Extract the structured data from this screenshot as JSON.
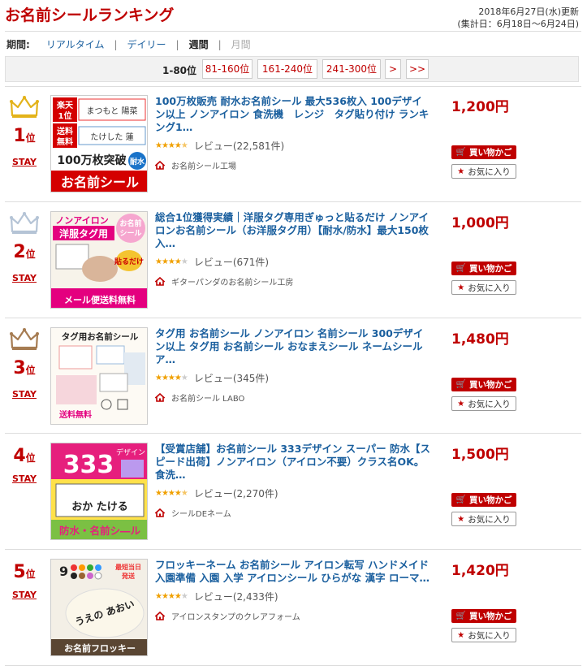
{
  "page": {
    "title": "お名前シールランキング",
    "updated_line1": "2018年6月27日(水)更新",
    "updated_line2": "(集計日：6月18日～6月24日)"
  },
  "period": {
    "label": "期間:",
    "options": [
      "リアルタイム",
      "デイリー",
      "週間",
      "月間"
    ],
    "selected": "週間"
  },
  "pagination": {
    "current": "1-80位",
    "pages": [
      "81-160位",
      "161-240位",
      "241-300位",
      ">",
      ">>"
    ]
  },
  "items": [
    {
      "rank": "1",
      "rank_suffix": "位",
      "movement": "STAY",
      "crown": "gold",
      "title": "100万枚販売 耐水お名前シール 最大536枚入 100デザイン以上 ノンアイロン 食洗機　レンジ　タグ貼り付け ランキング1…",
      "rating": 4.5,
      "reviews": "レビュー(22,581件)",
      "shop": "お名前シール工場",
      "price": "1,200円",
      "thumb": {
        "l1": "楽天1位",
        "l2": "まつもと 陽菜",
        "l3": "送料無料",
        "l4": "たけした 蓮",
        "l5": "100万枚突破",
        "l6": "耐水",
        "l7": "お名前シール"
      }
    },
    {
      "rank": "2",
      "rank_suffix": "位",
      "movement": "STAY",
      "crown": "silver",
      "title": "総合1位獲得実績｜洋服タグ専用ぎゅっと貼るだけ ノンアイロンお名前シール（お洋服タグ用）【耐水/防水】最大150枚入…",
      "rating": 4.0,
      "reviews": "レビュー(671件)",
      "shop": "ギターパンダのお名前シール工房",
      "price": "1,000円",
      "thumb": {
        "l1": "ノンアイロン",
        "l2": "洋服タグ用",
        "l3": "貼るだけ",
        "l4": "メール便送料無料"
      }
    },
    {
      "rank": "3",
      "rank_suffix": "位",
      "movement": "STAY",
      "crown": "bronze",
      "title": "タグ用 お名前シール ノンアイロン 名前シール 300デザイン以上 タグ用 お名前シール おなまえシール ネームシール ア…",
      "rating": 4.0,
      "reviews": "レビュー(345件)",
      "shop": "お名前シール LABO",
      "price": "1,480円",
      "thumb": {
        "l1": "タグ用お名前シール",
        "l2": "送料無料"
      }
    },
    {
      "rank": "4",
      "rank_suffix": "位",
      "movement": "STAY",
      "crown": "none",
      "title": "【受賞店舗】お名前シール 333デザイン スーパー 防水【スピード出荷】ノンアイロン（アイロン不要）クラス名OK。食洗…",
      "rating": 4.5,
      "reviews": "レビュー(2,270件)",
      "shop": "シールDEネーム",
      "price": "1,500円",
      "thumb": {
        "l1": "333",
        "l2": "デザイン",
        "l3": "おか たける",
        "l4": "防水・名前シ―ル"
      }
    },
    {
      "rank": "5",
      "rank_suffix": "位",
      "movement": "STAY",
      "crown": "none",
      "title": "フロッキーネーム お名前シール アイロン転写 ハンドメイド 入園準備 入園 入学 アイロンシール ひらがな 漢字 ローマ…",
      "rating": 4.0,
      "reviews": "レビュー(2,433件)",
      "shop": "アイロンスタンプのクレアフォーム",
      "price": "1,420円",
      "thumb": {
        "l1": "9",
        "l2": "最短当日発送",
        "l3": "お名前フロッキー"
      }
    }
  ],
  "buttons": {
    "cart": "買い物かご",
    "fav": "お気に入り"
  },
  "colors": {
    "brand_red": "#bf0000",
    "link_blue": "#1a5f9e",
    "star": "#f0a000"
  }
}
